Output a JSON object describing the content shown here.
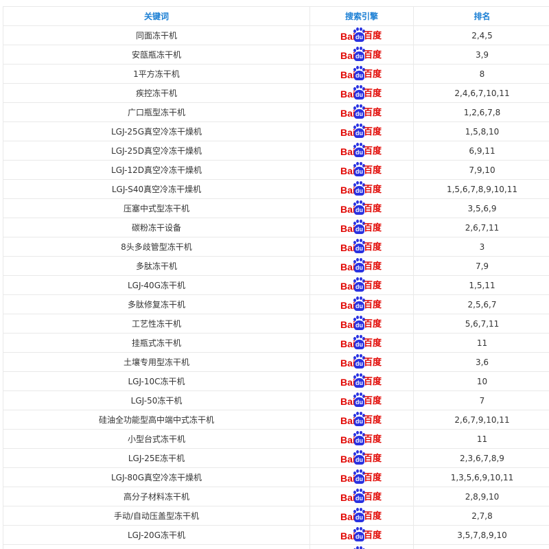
{
  "table": {
    "headers": {
      "keyword": "关键词",
      "engine": "搜索引擎",
      "rank": "排名"
    },
    "engine_logo": {
      "icon": "baidu-logo-icon",
      "text_bai": "Bai",
      "text_du": "du",
      "text_cn": "百度",
      "colors": {
        "red": "#e10602",
        "blue": "#2932e1"
      }
    },
    "rows": [
      {
        "keyword": "同面冻干机",
        "rank": "2,4,5"
      },
      {
        "keyword": "安瓿瓶冻干机",
        "rank": "3,9"
      },
      {
        "keyword": "1平方冻干机",
        "rank": "8"
      },
      {
        "keyword": "疾控冻干机",
        "rank": "2,4,6,7,10,11"
      },
      {
        "keyword": "广口瓶型冻干机",
        "rank": "1,2,6,7,8"
      },
      {
        "keyword": "LGJ-25G真空冷冻干燥机",
        "rank": "1,5,8,10"
      },
      {
        "keyword": "LGJ-25D真空冷冻干燥机",
        "rank": "6,9,11"
      },
      {
        "keyword": "LGJ-12D真空冷冻干燥机",
        "rank": "7,9,10"
      },
      {
        "keyword": "LGJ-S40真空冷冻干燥机",
        "rank": "1,5,6,7,8,9,10,11"
      },
      {
        "keyword": "压塞中式型冻干机",
        "rank": "3,5,6,9"
      },
      {
        "keyword": "碳粉冻干设备",
        "rank": "2,6,7,11"
      },
      {
        "keyword": "8头多歧管型冻干机",
        "rank": "3"
      },
      {
        "keyword": "多肽冻干机",
        "rank": "7,9"
      },
      {
        "keyword": "LGJ-40G冻干机",
        "rank": "1,5,11"
      },
      {
        "keyword": "多肽修复冻干机",
        "rank": "2,5,6,7"
      },
      {
        "keyword": "工艺性冻干机",
        "rank": "5,6,7,11"
      },
      {
        "keyword": "挂瓶式冻干机",
        "rank": "11"
      },
      {
        "keyword": "土壤专用型冻干机",
        "rank": "3,6"
      },
      {
        "keyword": "LGJ-10C冻干机",
        "rank": "10"
      },
      {
        "keyword": "LGJ-50冻干机",
        "rank": "7"
      },
      {
        "keyword": "硅油全功能型高中端中式冻干机",
        "rank": "2,6,7,9,10,11"
      },
      {
        "keyword": "小型台式冻干机",
        "rank": "11"
      },
      {
        "keyword": "LGJ-25E冻干机",
        "rank": "2,3,6,7,8,9"
      },
      {
        "keyword": "LGJ-80G真空冷冻干燥机",
        "rank": "1,3,5,6,9,10,11"
      },
      {
        "keyword": "高分子材料冻干机",
        "rank": "2,8,9,10"
      },
      {
        "keyword": "手动/自动压盖型冻干机",
        "rank": "2,7,8"
      },
      {
        "keyword": "LGJ-20G冻干机",
        "rank": "3,5,7,8,9,10"
      },
      {
        "keyword": "",
        "rank": ""
      }
    ]
  }
}
